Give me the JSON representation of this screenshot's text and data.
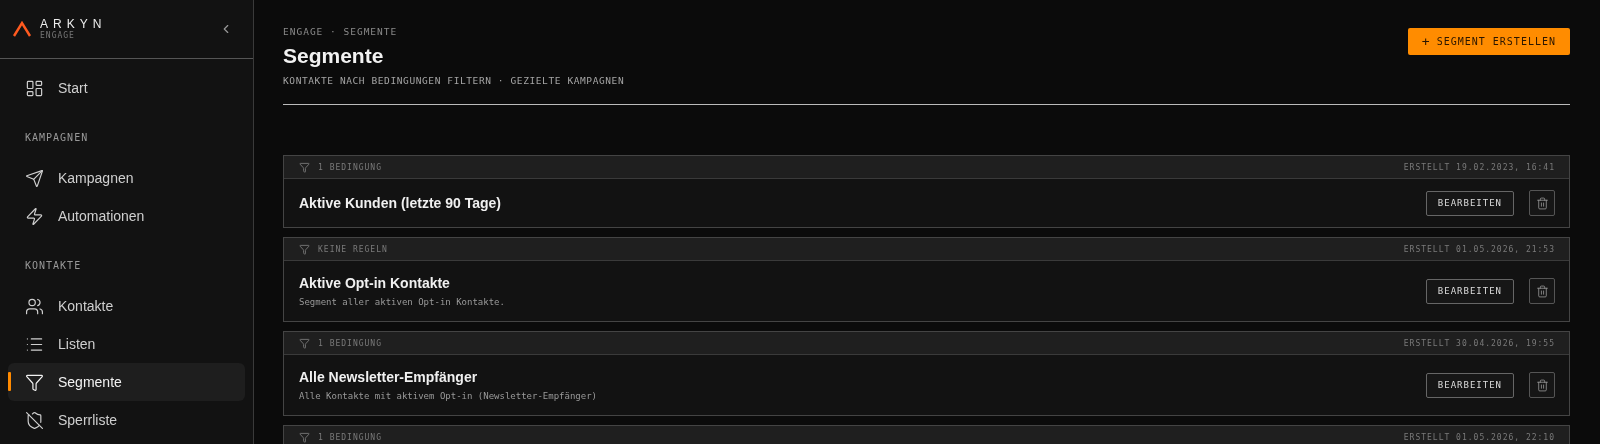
{
  "brand": {
    "name": "ARKYN",
    "product": "ENGAGE"
  },
  "sidebar": {
    "sections": [
      {
        "items": [
          {
            "label": "Start",
            "selected": false
          }
        ]
      },
      {
        "label": "KAMPAGNEN",
        "items": [
          {
            "label": "Kampagnen",
            "selected": false
          },
          {
            "label": "Automationen",
            "selected": false
          }
        ]
      },
      {
        "label": "KONTAKTE",
        "items": [
          {
            "label": "Kontakte",
            "selected": false
          },
          {
            "label": "Listen",
            "selected": false
          },
          {
            "label": "Segmente",
            "selected": true
          },
          {
            "label": "Sperrliste",
            "selected": false
          }
        ]
      }
    ]
  },
  "header": {
    "breadcrumb": "ENGAGE · SEGMENTE",
    "title": "Segmente",
    "subtitle": "KONTAKTE NACH BEDINGUNGEN FILTERN · GEZIELTE KAMPAGNEN",
    "action": "SEGMENT ERSTELLEN",
    "action_icon": "+"
  },
  "segments": [
    {
      "rules": "1 BEDINGUNG",
      "created": "ERSTELLT 19.02.2023, 16:41",
      "name": "Aktive Kunden (letzte 90 Tage)",
      "edit": "BEARBEITEN"
    },
    {
      "rules": "KEINE REGELN",
      "created": "ERSTELLT 01.05.2026, 21:53",
      "name": "Aktive Opt-in Kontakte",
      "description": "Segment aller aktiven Opt-in Kontakte.",
      "edit": "BEARBEITEN"
    },
    {
      "rules": "1 BEDINGUNG",
      "created": "ERSTELLT 30.04.2026, 19:55",
      "name": "Alle Newsletter-Empfänger",
      "description": "Alle Kontakte mit aktivem Opt-in (Newsletter-Empfänger)",
      "edit": "BEARBEITEN"
    },
    {
      "rules": "1 BEDINGUNG",
      "created": "ERSTELLT 01.05.2026, 22:10"
    }
  ]
}
